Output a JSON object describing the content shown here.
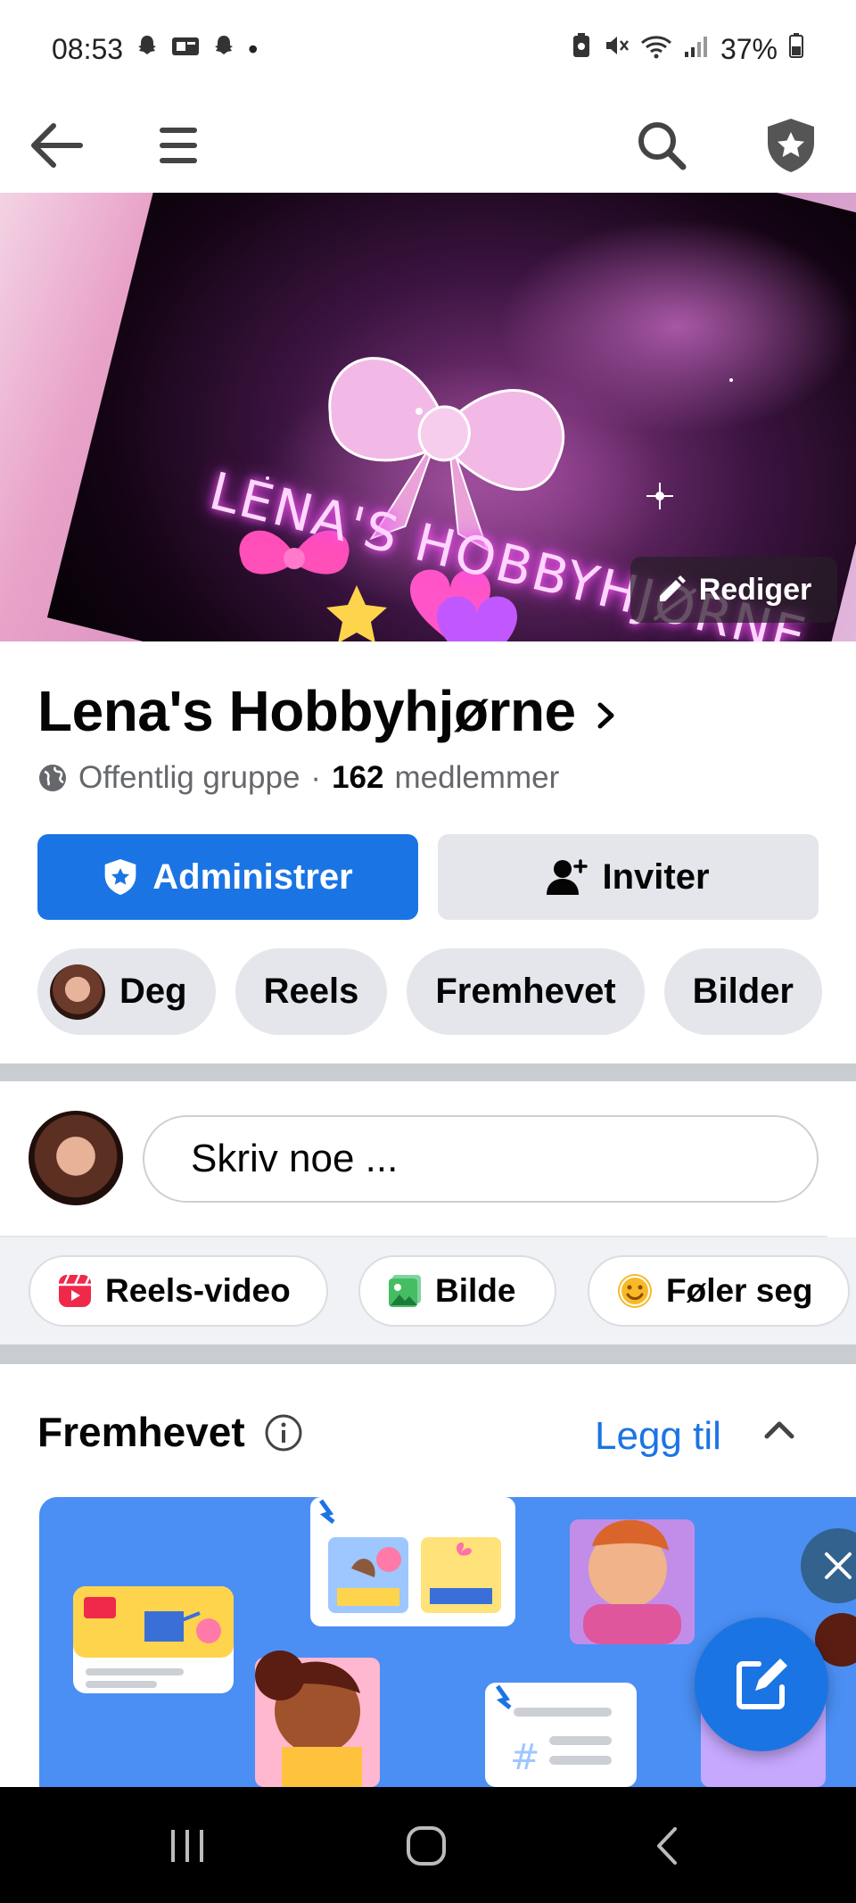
{
  "status_bar": {
    "time": "08:53",
    "dot": "•",
    "battery": "37%"
  },
  "cover": {
    "title": "LENA'S HOBBYHJØRNE",
    "edit_label": "Rediger"
  },
  "group": {
    "name": "Lena's Hobbyhjørne",
    "privacy": "Offentlig gruppe",
    "separator": "·",
    "member_count": "162",
    "member_label": "medlemmer"
  },
  "actions": {
    "manage_label": "Administrer",
    "invite_label": "Inviter"
  },
  "chips": [
    {
      "label": "Deg"
    },
    {
      "label": "Reels"
    },
    {
      "label": "Fremhevet"
    },
    {
      "label": "Bilder"
    }
  ],
  "composer": {
    "placeholder": "Skriv noe ..."
  },
  "quick_actions": [
    {
      "label": "Reels-video",
      "icon": "reels-icon"
    },
    {
      "label": "Bilde",
      "icon": "photo-icon"
    },
    {
      "label": "Føler seg",
      "icon": "smiley-icon"
    }
  ],
  "featured": {
    "title": "Fremhevet",
    "add_label": "Legg til"
  },
  "colors": {
    "accent": "#1b74e4",
    "chip_bg": "#e4e6eb",
    "banner": "#4b8ff4"
  }
}
